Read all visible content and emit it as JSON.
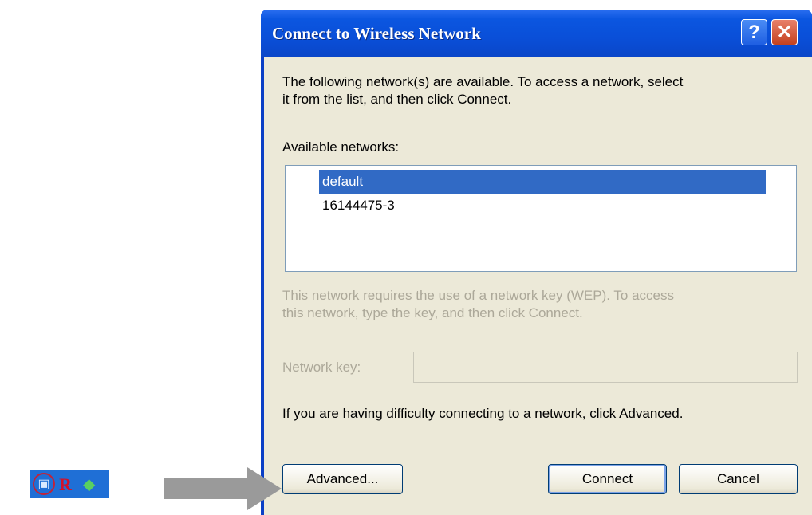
{
  "dialog": {
    "title": "Connect to Wireless Network",
    "help_glyph": "?",
    "close_glyph": "✕",
    "intro_line1": "The following network(s) are available. To access a network, select",
    "intro_line2": "it from the list, and then click Connect.",
    "available_label": "Available networks:",
    "networks": [
      {
        "name": "default",
        "selected": true
      },
      {
        "name": "16144475-3",
        "selected": false
      }
    ],
    "wep_line1": "This network requires the use of a network key (WEP). To access",
    "wep_line2": "this network, type the key, and then click Connect.",
    "network_key_label": "Network key:",
    "network_key_value": "",
    "difficulty_text": "If you are having difficulty connecting to a network, click Advanced.",
    "advanced_label": "Advanced...",
    "connect_label": "Connect",
    "cancel_label": "Cancel"
  },
  "tray": {
    "icons": [
      "network-icon",
      "r-app-icon",
      "green-app-icon"
    ]
  },
  "colors": {
    "titlebar": "#0a4fd8",
    "selection": "#316ac5",
    "dialog_face": "#ece9d8",
    "close_button": "#c4411e",
    "arrow": "#9a9a9a",
    "tray_background": "#1f6fd6"
  }
}
